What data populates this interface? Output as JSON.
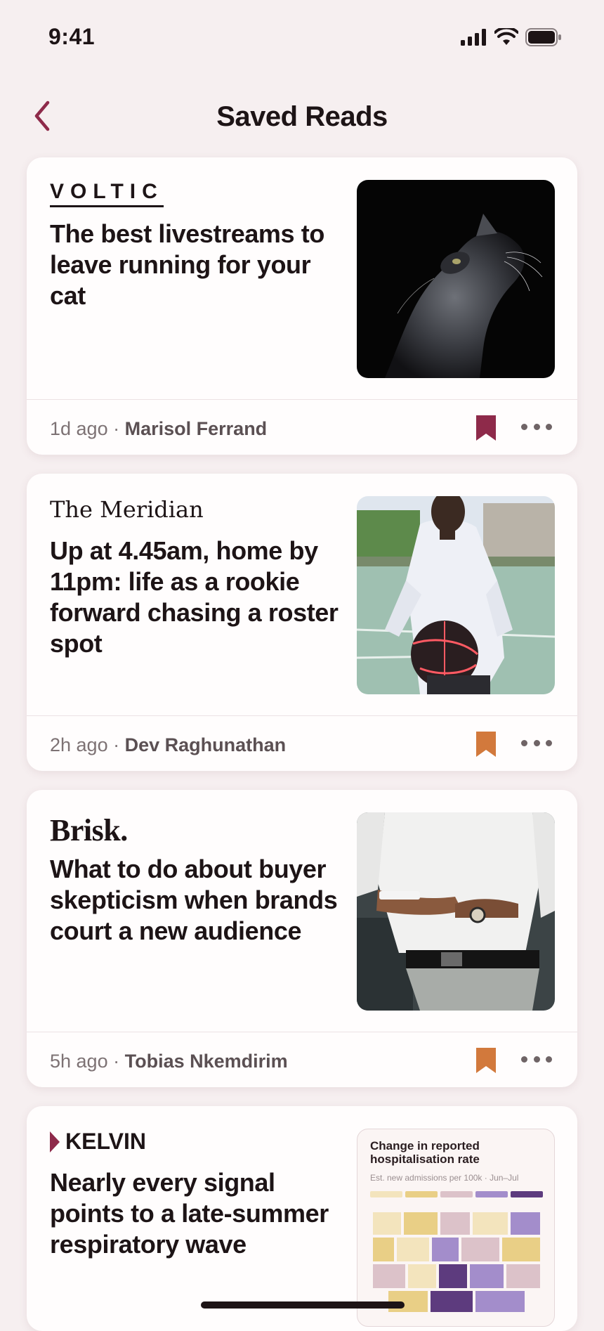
{
  "status": {
    "time": "9:41"
  },
  "nav": {
    "title": "Saved Reads"
  },
  "articles": [
    {
      "publication": "VOLTIC",
      "title": "The best livestreams to leave running for your cat",
      "age": "1d ago",
      "author": "Marisol Ferrand",
      "bookmark_color": "#8e2a4a",
      "thumbnail": "cat-photo"
    },
    {
      "publication": "The Meridian",
      "title": "Up at 4.45am, home by 11pm: life as a rookie forward chasing a roster spot",
      "age": "2h ago",
      "author": "Dev Raghunathan",
      "bookmark_color": "#d2793c",
      "thumbnail": "basketball-player-photo"
    },
    {
      "publication": "Brisk.",
      "title": "What to do about buyer skepticism when brands court a new audience",
      "age": "5h ago",
      "author": "Tobias Nkemdirim",
      "bookmark_color": "#d2793c",
      "thumbnail": "man-with-phone-photo"
    },
    {
      "publication": "KELVIN",
      "title": "Nearly every signal points to a late-summer respiratory wave",
      "thumbnail": "heatmap-chart",
      "chart": {
        "title": "Change in reported hospitalisation rate",
        "subtitle": "Est. new admissions per 100k · Jun–Jul"
      }
    }
  ],
  "separator": "·",
  "colors": {
    "accent": "#8e2a4a",
    "orange": "#d2793c"
  }
}
